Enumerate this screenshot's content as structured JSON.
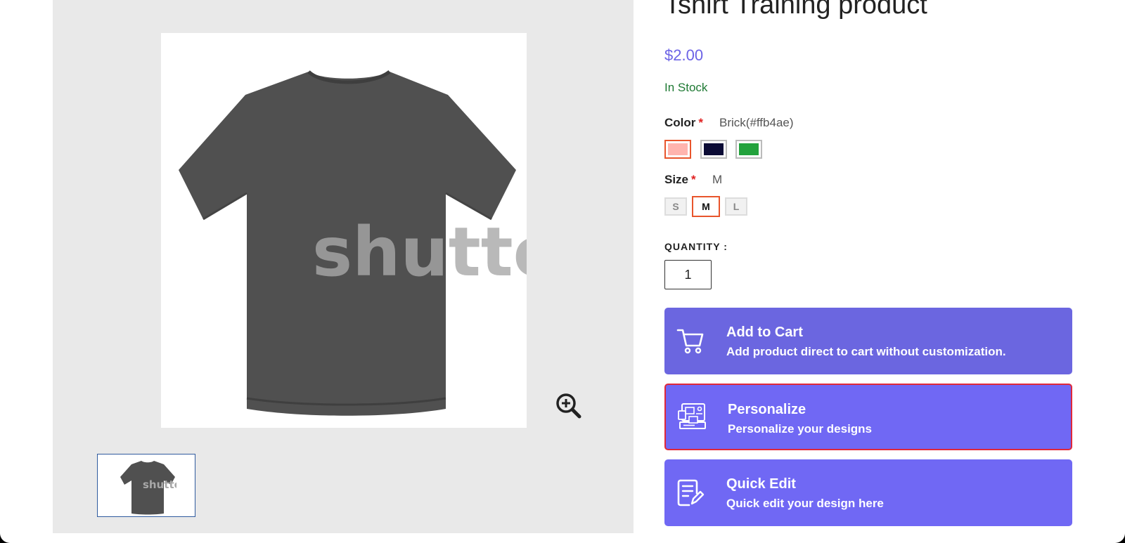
{
  "product": {
    "title": "Tshirt Training product",
    "price": "$2.00",
    "stock": "In Stock"
  },
  "options": {
    "color": {
      "label": "Color",
      "required_mark": "*",
      "selected_value": "Brick(#ffb4ae)",
      "swatches": [
        {
          "name": "Brick",
          "hex": "#ffb4ae",
          "selected": true
        },
        {
          "name": "Navy",
          "hex": "#0b0b35",
          "selected": false
        },
        {
          "name": "Green",
          "hex": "#22a23c",
          "selected": false
        }
      ]
    },
    "size": {
      "label": "Size",
      "required_mark": "*",
      "selected_value": "M",
      "choices": [
        "S",
        "M",
        "L"
      ]
    }
  },
  "quantity": {
    "label": "QUANTITY :",
    "value": "1"
  },
  "actions": {
    "add_to_cart": {
      "title": "Add to Cart",
      "subtitle": "Add product direct to cart without customization.",
      "icon": "cart-icon"
    },
    "personalize": {
      "title": "Personalize",
      "subtitle": "Personalize your designs",
      "icon": "design-layout-icon"
    },
    "quick_edit": {
      "title": "Quick Edit",
      "subtitle": "Quick edit your design here",
      "icon": "edit-document-icon"
    }
  },
  "gallery": {
    "watermark": "shutter",
    "zoom_icon": "zoom-in-icon"
  },
  "colors": {
    "accent": "#6b66e0",
    "accent_light": "#7068f4",
    "price": "#6c63e6",
    "stock": "#1f7a34",
    "selected_border": "#e8552c",
    "highlight_border": "#e0283a"
  }
}
